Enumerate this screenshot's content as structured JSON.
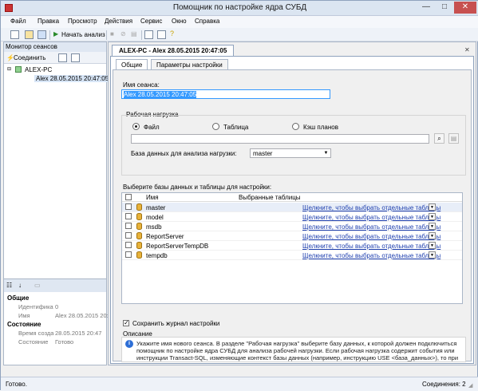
{
  "window": {
    "title": "Помощник по настройке ядра СУБД",
    "min": "—",
    "max": "□",
    "close": "✕"
  },
  "menu": [
    "Файл",
    "Правка",
    "Просмотр",
    "Действия",
    "Сервис",
    "Окно",
    "Справка"
  ],
  "toolbar": {
    "start_label": "Начать анализ"
  },
  "session_monitor": {
    "title": "Монитор сеансов",
    "connect_label": "Соединить",
    "tree": {
      "server": "ALEX-PC",
      "session": "Alex 28.05.2015 20:47:05"
    }
  },
  "properties": {
    "cat_general": "Общие",
    "rows_general": [
      {
        "k": "Идентифика",
        "v": "0"
      },
      {
        "k": "Имя",
        "v": "Alex 28.05.2015 20:47:05"
      }
    ],
    "cat_state": "Состояние",
    "rows_state": [
      {
        "k": "Время созда",
        "v": "28.05.2015 20:47"
      },
      {
        "k": "Состояние",
        "v": "Готово"
      }
    ]
  },
  "document": {
    "tab_label": "ALEX-PC - Alex 28.05.2015 20:47:05",
    "close_x": "✕",
    "subtabs": {
      "general": "Общие",
      "params": "Параметры настройки"
    },
    "session_name_label": "Имя сеанса:",
    "session_name_value": "Alex 28.05.2015 20:47:05",
    "workload_label": "Рабочая нагрузка",
    "radio_file": "Файл",
    "radio_table": "Таблица",
    "radio_cache": "Кэш планов",
    "db_for_analysis_label": "База данных для анализа нагрузки:",
    "db_for_analysis_value": "master",
    "select_db_label": "Выберите базы данных и таблицы для настройки:",
    "grid_col_name": "Имя",
    "grid_col_tables": "Выбранные таблицы",
    "link_text": "Щелкните, чтобы выбрать отдельные таблицы",
    "databases": [
      "master",
      "model",
      "msdb",
      "ReportServer",
      "ReportServerTempDB",
      "tempdb"
    ],
    "save_log_label": "Сохранить журнал настройки",
    "description_title": "Описание",
    "description_text": "Укажите имя нового сеанса. В разделе \"Рабочая нагрузка\" выберите базу данных, к которой должен подключиться помощник по настройке ядра СУБД для анализа рабочей нагрузки. Если рабочая нагрузка содержит события или инструкции Transact-SQL, изменяющие контекст базы данных (например, инструкцию USE <база_данных>), то при анализе рабочей нагрузки помощник по настройке ядра СУБД также изменит контекст базы данных. Наконец, выберите одну или"
  },
  "status": {
    "left": "Готово.",
    "right": "Соединения: 2"
  },
  "colors": {
    "accent": "#3399ff",
    "link": "#1e3fae",
    "title_bg": "#dbe5f1"
  }
}
